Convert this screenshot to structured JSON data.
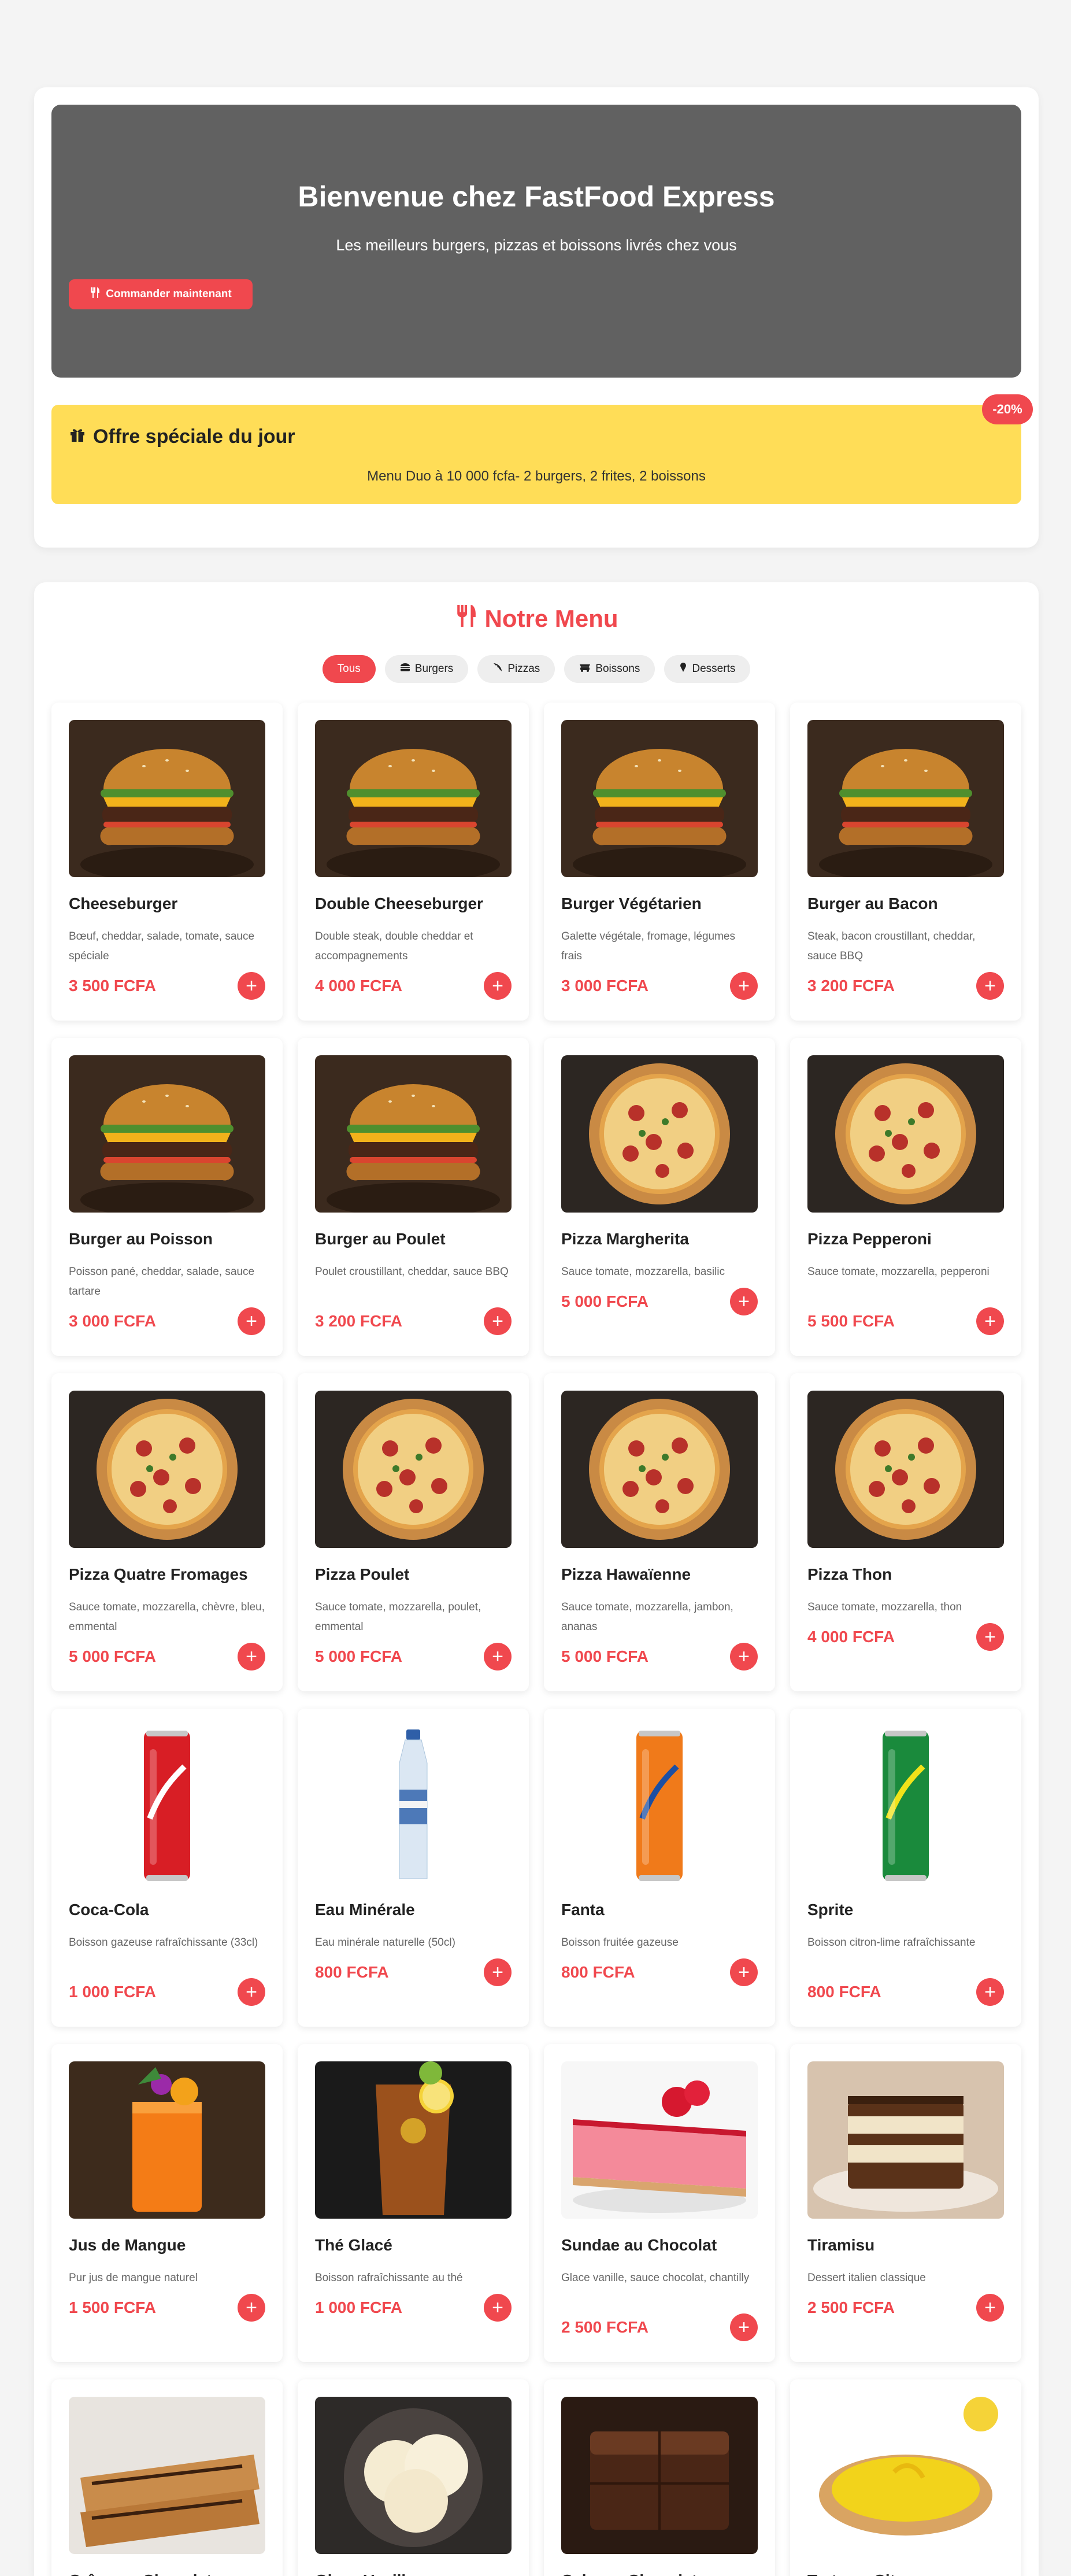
{
  "hero": {
    "title": "Bienvenue chez FastFood Express",
    "subtitle": "Les meilleurs burgers, pizzas et boissons livrés chez vous",
    "cta_label": "Commander maintenant"
  },
  "offer": {
    "title": "Offre spéciale du jour",
    "text": "Menu Duo à 10 000 fcfa- 2 burgers, 2 frites, 2 boissons",
    "badge": "-20%"
  },
  "menu": {
    "title": "Notre Menu",
    "filters": [
      {
        "label": "Tous",
        "icon": "",
        "active": true
      },
      {
        "label": "Burgers",
        "icon": "burger-icon",
        "active": false
      },
      {
        "label": "Pizzas",
        "icon": "pizza-slice-icon",
        "active": false
      },
      {
        "label": "Boissons",
        "icon": "drink-icon",
        "active": false
      },
      {
        "label": "Desserts",
        "icon": "ice-cream-icon",
        "active": false
      }
    ],
    "add_label": "+",
    "items": [
      {
        "name": "Cheeseburger",
        "desc": "Bœuf, cheddar, salade, tomate, sauce spéciale",
        "price": "3 500 FCFA",
        "img": "burger"
      },
      {
        "name": "Double Cheeseburger",
        "desc": "Double steak, double cheddar et accompagnements",
        "price": "4 000 FCFA",
        "img": "burger"
      },
      {
        "name": "Burger Végétarien",
        "desc": "Galette végétale, fromage, légumes frais",
        "price": "3 000 FCFA",
        "img": "burger"
      },
      {
        "name": "Burger au Bacon",
        "desc": "Steak, bacon croustillant, cheddar, sauce BBQ",
        "price": "3 200 FCFA",
        "img": "burger"
      },
      {
        "name": "Burger au Poisson",
        "desc": "Poisson pané, cheddar, salade, sauce tartare",
        "price": "3 000 FCFA",
        "img": "burger"
      },
      {
        "name": "Burger au Poulet",
        "desc": "Poulet croustillant, cheddar, sauce BBQ",
        "price": "3 200 FCFA",
        "img": "burger"
      },
      {
        "name": "Pizza Margherita",
        "desc": "Sauce tomate, mozzarella, basilic",
        "price": "5 000 FCFA",
        "img": "pizza"
      },
      {
        "name": "Pizza Pepperoni",
        "desc": "Sauce tomate, mozzarella, pepperoni",
        "price": "5 500 FCFA",
        "img": "pizza"
      },
      {
        "name": "Pizza Quatre Fromages",
        "desc": "Sauce tomate, mozzarella, chèvre, bleu, emmental",
        "price": "5 000 FCFA",
        "img": "pizza"
      },
      {
        "name": "Pizza Poulet",
        "desc": "Sauce tomate, mozzarella, poulet, emmental",
        "price": "5 000 FCFA",
        "img": "pizza"
      },
      {
        "name": "Pizza Hawaïenne",
        "desc": "Sauce tomate, mozzarella, jambon, ananas",
        "price": "5 000 FCFA",
        "img": "pizza"
      },
      {
        "name": "Pizza Thon",
        "desc": "Sauce tomate, mozzarella, thon",
        "price": "4 000 FCFA",
        "img": "pizza"
      },
      {
        "name": "Coca-Cola",
        "desc": "Boisson gazeuse rafraîchissante (33cl)",
        "price": "1 000 FCFA",
        "img": "can-red"
      },
      {
        "name": "Eau Minérale",
        "desc": "Eau minérale naturelle (50cl)",
        "price": "800 FCFA",
        "img": "bottle"
      },
      {
        "name": "Fanta",
        "desc": "Boisson fruitée gazeuse",
        "price": "800 FCFA",
        "img": "can-orange"
      },
      {
        "name": "Sprite",
        "desc": "Boisson citron-lime rafraîchissante",
        "price": "800 FCFA",
        "img": "can-green"
      },
      {
        "name": "Jus de Mangue",
        "desc": "Pur jus de mangue naturel",
        "price": "1 500 FCFA",
        "img": "juice"
      },
      {
        "name": "Thé Glacé",
        "desc": "Boisson rafraîchissante au thé",
        "price": "1 000 FCFA",
        "img": "tea"
      },
      {
        "name": "Sundae au Chocolat",
        "desc": "Glace vanille, sauce chocolat, chantilly",
        "price": "2 500 FCFA",
        "img": "cake-pink"
      },
      {
        "name": "Tiramisu",
        "desc": "Dessert italien classique",
        "price": "2 500 FCFA",
        "img": "tiramisu"
      },
      {
        "name": "Crêpe au Chocolat",
        "desc": "",
        "price": "",
        "img": "crepe"
      },
      {
        "name": "Glace Vanille",
        "desc": "",
        "price": "",
        "img": "icecream"
      },
      {
        "name": "Cake au Chocolat",
        "desc": "",
        "price": "",
        "img": "brownie"
      },
      {
        "name": "Tarte au Citron",
        "desc": "",
        "price": "",
        "img": "tart"
      }
    ]
  }
}
